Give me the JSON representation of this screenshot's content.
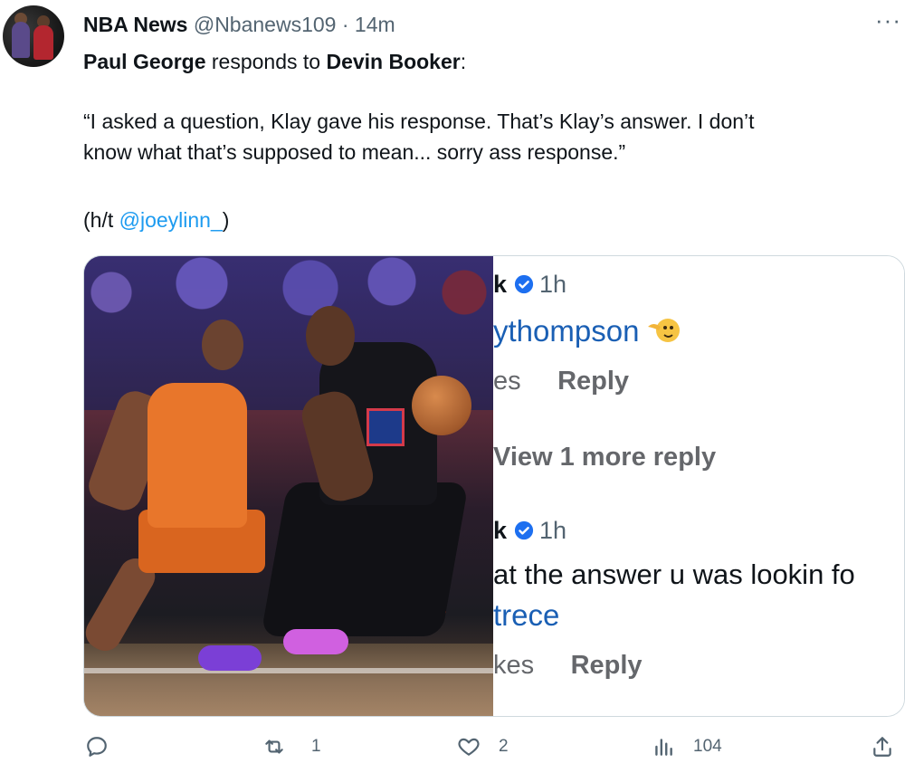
{
  "tweet": {
    "author_name": "NBA News",
    "author_handle": "@Nbanews109",
    "separator": "·",
    "time": "14m",
    "more": "···",
    "line1_bold1": "Paul George",
    "line1_mid": " responds to ",
    "line1_bold2": "Devin Booker",
    "line1_end": ":",
    "quote_line1": "“I asked a question, Klay gave his response. That’s Klay’s answer. I don’t",
    "quote_line2": "know what that’s supposed to mean... sorry ass response.”",
    "ht_prefix": "(h/t ",
    "ht_link": "@joeylinn_",
    "ht_suffix": ")"
  },
  "screenshot": {
    "c1_name": "k",
    "c1_time": "1h",
    "c1_user": "ythompson",
    "c1_likes": "es",
    "c1_reply": "Reply",
    "view_more": "View 1 more reply",
    "c2_name": "k",
    "c2_time": "1h",
    "c2_body": "at the answer u was lookin fo",
    "c2_user": "trece",
    "c2_likes": "kes",
    "c2_reply": "Reply"
  },
  "actions": {
    "replies": "",
    "retweets": "1",
    "likes": "2",
    "views": "104"
  },
  "icons": {
    "reply": "reply-icon",
    "retweet": "retweet-icon",
    "like": "heart-icon",
    "views": "views-icon",
    "share": "share-icon"
  }
}
